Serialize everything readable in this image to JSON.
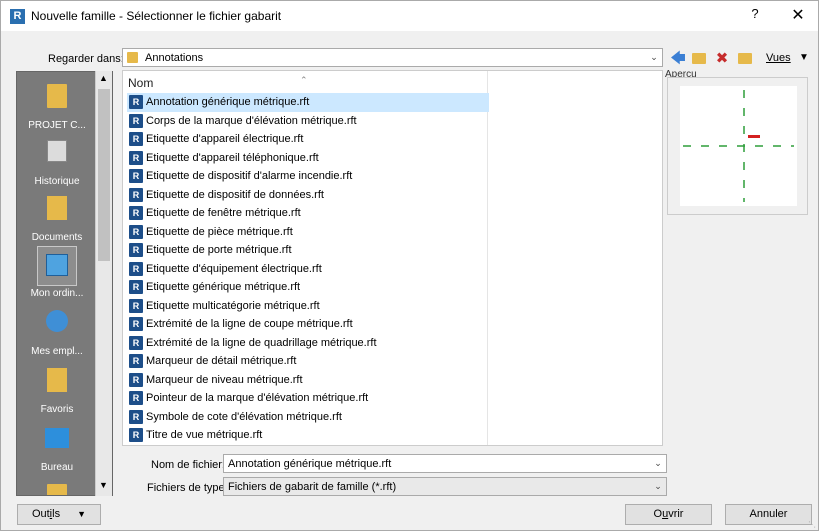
{
  "window": {
    "title": "Nouvelle famille - Sélectionner le fichier gabarit",
    "app_icon_letter": "R",
    "help_label": "?",
    "close_label": "✕"
  },
  "toolbar": {
    "look_in_label": "Regarder dans:",
    "look_in_value": "Annotations",
    "views_label": "Vues"
  },
  "places": [
    {
      "label": "PROJET C...",
      "icon": "folder-icon"
    },
    {
      "label": "Historique",
      "icon": "history-icon"
    },
    {
      "label": "Documents",
      "icon": "documents-icon"
    },
    {
      "label": "Mon ordin...",
      "icon": "computer-icon"
    },
    {
      "label": "Mes empl...",
      "icon": "network-places-icon"
    },
    {
      "label": "Favoris",
      "icon": "favorites-icon"
    },
    {
      "label": "Bureau",
      "icon": "desktop-icon"
    }
  ],
  "file_list": {
    "column_header": "Nom",
    "files": [
      "Annotation générique métrique.rft",
      "Corps de la marque d'élévation métrique.rft",
      "Etiquette d'appareil électrique.rft",
      "Etiquette d'appareil téléphonique.rft",
      "Etiquette de dispositif d'alarme incendie.rft",
      "Etiquette de dispositif de données.rft",
      "Etiquette de fenêtre métrique.rft",
      "Etiquette de pièce métrique.rft",
      "Etiquette de porte métrique.rft",
      "Etiquette d'équipement électrique.rft",
      "Etiquette générique métrique.rft",
      "Etiquette multicatégorie métrique.rft",
      "Extrémité de la ligne de coupe métrique.rft",
      "Extrémité de la ligne de quadrillage métrique.rft",
      "Marqueur de détail métrique.rft",
      "Marqueur de niveau métrique.rft",
      "Pointeur de la marque d'élévation métrique.rft",
      "Symbole de cote d'élévation métrique.rft",
      "Titre de vue métrique.rft"
    ],
    "selected_index": 0
  },
  "preview": {
    "label": "Aperçu"
  },
  "filename": {
    "label": "Nom de fichier:",
    "value": "Annotation générique métrique.rft"
  },
  "filetype": {
    "label": "Fichiers de type:",
    "value": "Fichiers de gabarit de famille  (*.rft)"
  },
  "buttons": {
    "tools": "Outils",
    "open": "Ouvrir",
    "cancel": "Annuler"
  },
  "colors": {
    "selection": "#cce8ff",
    "places_bg": "#7a7a7a",
    "rft_icon": "#1d4e89",
    "preview_line": "#2e9e3a",
    "preview_marker": "#d42020"
  }
}
